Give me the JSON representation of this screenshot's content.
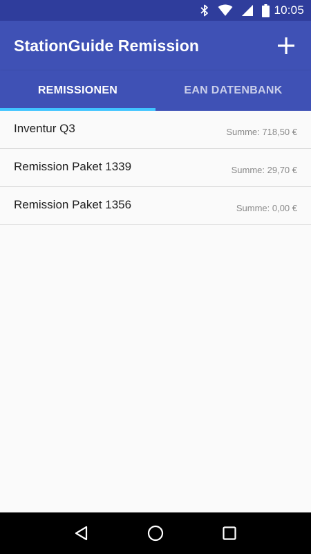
{
  "status_bar": {
    "time": "10:05",
    "icons": [
      "bluetooth-icon",
      "wifi-icon",
      "signal-icon",
      "battery-icon"
    ]
  },
  "app_bar": {
    "title": "StationGuide Remission",
    "action_icon": "add-icon"
  },
  "tabs": [
    {
      "label": "REMISSIONEN",
      "active": true
    },
    {
      "label": "EAN DATENBANK",
      "active": false
    }
  ],
  "list": [
    {
      "name": "Inventur Q3",
      "sum": "Summe: 718,50 €"
    },
    {
      "name": "Remission Paket 1339",
      "sum": "Summe: 29,70 €"
    },
    {
      "name": "Remission Paket 1356",
      "sum": "Summe: 0,00 €"
    }
  ],
  "nav_bar": {
    "icons": [
      "back-icon",
      "home-icon",
      "recents-icon"
    ]
  },
  "colors": {
    "primary": "#3f51b5",
    "primary_dark": "#2f3d9c",
    "tab_indicator": "#40c4ff",
    "background": "#fafafa"
  }
}
